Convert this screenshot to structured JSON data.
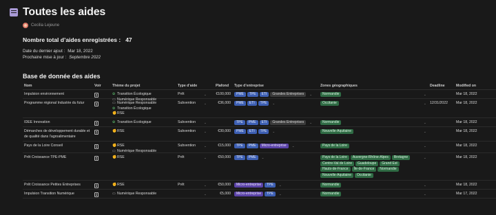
{
  "page": {
    "title": "Toutes les aides",
    "author": "Cecilia Lejeune",
    "total_label": "Nombre total d’aides enregistrées :",
    "total_value": "47",
    "last_added_label": "Date du dernier ajout :",
    "last_added_value": "Mar 18, 2022",
    "next_update_label": "Prochaine mise à jour :",
    "next_update_value": "Septembre 2022"
  },
  "database": {
    "title": "Base de donnée des aides",
    "columns": {
      "nom": "Nom",
      "voir": "Voir",
      "theme": "Thème du projet",
      "type_aide": "Type d’aide",
      "plafond": "Plafond",
      "type_entreprise": "Type d’entreprise",
      "zones": "Zones géographiques",
      "deadline": "Deadline",
      "modified": "Modified on"
    },
    "colors": {
      "blue_tag": "#3d5fb3",
      "purple_tag": "#5b43a8",
      "gray_tag": "#3a3a3a",
      "green_tag": "#2f6b44"
    },
    "rows": [
      {
        "name": "Impulsion environnement",
        "themes": [
          {
            "icon": "leaf-icon",
            "label": "Transition Écologique"
          },
          {
            "icon": "laptop-icon",
            "label": "Numérique Responsable"
          }
        ],
        "aid_type": "Prêt",
        "ceiling": "€100,000",
        "companies": [
          {
            "label": "PME",
            "color": "blue"
          },
          {
            "label": "TPE",
            "color": "blue"
          },
          {
            "label": "ETI",
            "color": "blue"
          },
          {
            "label": "Grandes Entreprises",
            "color": "gray"
          }
        ],
        "zones": [
          "Normandie"
        ],
        "deadline": "",
        "modified": "Mar 18, 2022"
      },
      {
        "name": "Programme régional Industrie du futur",
        "themes": [
          {
            "icon": "laptop-icon",
            "label": "Numérique Responsable"
          },
          {
            "icon": "leaf-icon",
            "label": "Transition Écologique"
          },
          {
            "icon": "arm-icon",
            "label": "RSE"
          }
        ],
        "aid_type": "Subvention",
        "ceiling": "€36,000",
        "companies": [
          {
            "label": "PME",
            "color": "blue"
          },
          {
            "label": "ETI",
            "color": "blue"
          },
          {
            "label": "TPE",
            "color": "blue"
          }
        ],
        "zones": [
          "Occitanie"
        ],
        "deadline": "12/31/2022",
        "modified": "Mar 18, 2022"
      },
      {
        "name": "IDEE Innovation",
        "themes": [
          {
            "icon": "leaf-icon",
            "label": "Transition Écologique"
          }
        ],
        "aid_type": "Subvention",
        "ceiling": "",
        "companies": [
          {
            "label": "TPE",
            "color": "blue"
          },
          {
            "label": "PME",
            "color": "blue"
          },
          {
            "label": "ETI",
            "color": "blue"
          },
          {
            "label": "Grandes Entreprises",
            "color": "gray"
          }
        ],
        "zones": [
          "Normandie"
        ],
        "deadline": "",
        "modified": "Mar 18, 2022"
      },
      {
        "name": "Démarches de développement durable et de qualité dans l’agroalimentaire",
        "themes": [
          {
            "icon": "arm-icon",
            "label": "RSE"
          }
        ],
        "aid_type": "Subvention",
        "ceiling": "€30,000",
        "companies": [
          {
            "label": "PME",
            "color": "blue"
          },
          {
            "label": "ETI",
            "color": "blue"
          },
          {
            "label": "TPE",
            "color": "blue"
          }
        ],
        "zones": [
          "Nouvelle-Aquitaine"
        ],
        "deadline": "",
        "modified": "Mar 18, 2022"
      },
      {
        "name": "Pays de la Loire Conseil",
        "themes": [
          {
            "icon": "arm-icon",
            "label": "RSE"
          },
          {
            "icon": "laptop-icon",
            "label": "Numérique Responsable"
          }
        ],
        "aid_type": "Subvention",
        "ceiling": "€15,000",
        "companies": [
          {
            "label": "TPE",
            "color": "blue"
          },
          {
            "label": "PME",
            "color": "blue"
          },
          {
            "label": "Micro-entreprise",
            "color": "purple"
          }
        ],
        "zones": [
          "Pays de la Loire"
        ],
        "deadline": "",
        "modified": "Mar 18, 2022"
      },
      {
        "name": "Prêt Croissance TPE-PME",
        "themes": [
          {
            "icon": "arm-icon",
            "label": "RSE"
          }
        ],
        "aid_type": "Prêt",
        "ceiling": "€50,000",
        "companies": [
          {
            "label": "TPE",
            "color": "blue"
          },
          {
            "label": "PME",
            "color": "blue"
          }
        ],
        "zones": [
          "Pays de la Loire",
          "Auvergne-Rhône-Alpes",
          "Bretagne",
          "Centre-Val de Loire",
          "Guadeloupe",
          "Grand Est",
          "Hauts-de-France",
          "Île-de-France",
          "Normandie",
          "Nouvelle-Aquitaine",
          "Occitanie"
        ],
        "deadline": "",
        "modified": "Mar 18, 2022"
      },
      {
        "name": "Prêt Croissance Petites Entreprises",
        "themes": [
          {
            "icon": "arm-icon",
            "label": "RSE"
          }
        ],
        "aid_type": "Prêt",
        "ceiling": "€50,000",
        "companies": [
          {
            "label": "Micro-entreprise",
            "color": "purple"
          },
          {
            "label": "TPE",
            "color": "blue"
          }
        ],
        "zones": [
          "Normandie"
        ],
        "deadline": "",
        "modified": "Mar 18, 2022"
      },
      {
        "name": "Impulsion Transition Numérique",
        "themes": [
          {
            "icon": "laptop-icon",
            "label": "Numérique Responsable"
          }
        ],
        "aid_type": "",
        "ceiling": "€5,000",
        "companies": [
          {
            "label": "Micro-entreprise",
            "color": "purple"
          },
          {
            "label": "TPE",
            "color": "blue"
          }
        ],
        "zones": [
          "Normandie"
        ],
        "deadline": "",
        "modified": "Mar 17, 2022"
      }
    ]
  }
}
